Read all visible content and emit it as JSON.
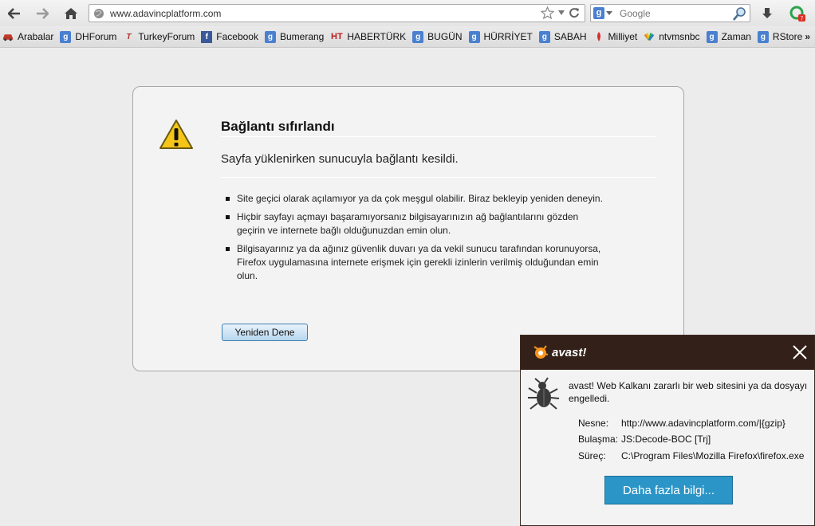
{
  "browser": {
    "url": "www.adavincplatform.com",
    "search_placeholder": "Google",
    "search_engine_icon": "google-g-icon"
  },
  "bookmarks": [
    {
      "label": "Arabalar",
      "icon": "car-icon",
      "color": "#c0392b"
    },
    {
      "label": "DHForum",
      "icon": "google-g-icon",
      "color": "#4a80cf"
    },
    {
      "label": "TurkeyForum",
      "icon": "tf-icon",
      "color": "#b0302a"
    },
    {
      "label": "Facebook",
      "icon": "facebook-icon",
      "color": "#3b5998"
    },
    {
      "label": "Bumerang",
      "icon": "google-g-icon",
      "color": "#4a80cf"
    },
    {
      "label": "HABERTÜRK",
      "icon": "ht-icon",
      "color": "#b71c1c"
    },
    {
      "label": "BUGÜN",
      "icon": "google-g-icon",
      "color": "#4a80cf"
    },
    {
      "label": "HÜRRİYET",
      "icon": "google-g-icon",
      "color": "#4a80cf"
    },
    {
      "label": "SABAH",
      "icon": "google-g-icon",
      "color": "#4a80cf"
    },
    {
      "label": "Milliyet",
      "icon": "milliyet-icon",
      "color": "#d32f2f"
    },
    {
      "label": "ntvmsnbc",
      "icon": "peacock-icon",
      "color": "#e67e22"
    },
    {
      "label": "Zaman",
      "icon": "google-g-icon",
      "color": "#4a80cf"
    },
    {
      "label": "RStore",
      "icon": "google-g-icon",
      "color": "#4a80cf"
    }
  ],
  "bookmarks_more": "»",
  "error": {
    "title": "Bağlantı sıfırlandı",
    "subtitle": "Sayfa yüklenirken sunucuyla bağlantı kesildi.",
    "items": [
      "Site geçici olarak açılamıyor ya da çok meşgul olabilir. Biraz bekleyip yeniden deneyin.",
      "Hiçbir sayfayı açmayı başaramıyorsanız bilgisayarınızın ağ bağlantılarını gözden geçirin ve internete bağlı olduğunuzdan emin olun.",
      "Bilgisayarınız ya da ağınız güvenlik duvarı ya da vekil sunucu tarafından korunuyorsa, Firefox uygulamasına internete erişmek için gerekli izinlerin verilmiş olduğundan emin olun."
    ],
    "retry_label": "Yeniden Dene"
  },
  "avast": {
    "brand": "avast!",
    "message": "avast! Web Kalkanı zararlı bir web sitesini ya da dosyayı engelledi.",
    "object_label": "Nesne:",
    "object_value": "http://www.adavincplatform.com/|{gzip}",
    "infection_label": "Bulaşma:",
    "infection_value": "JS:Decode-BOC [Trj]",
    "process_label": "Süreç:",
    "process_value": "C:\\Program Files\\Mozilla Firefox\\firefox.exe",
    "more_info_label": "Daha fazla bilgi...",
    "accent_color": "#2b95c7",
    "header_color": "#332119"
  }
}
